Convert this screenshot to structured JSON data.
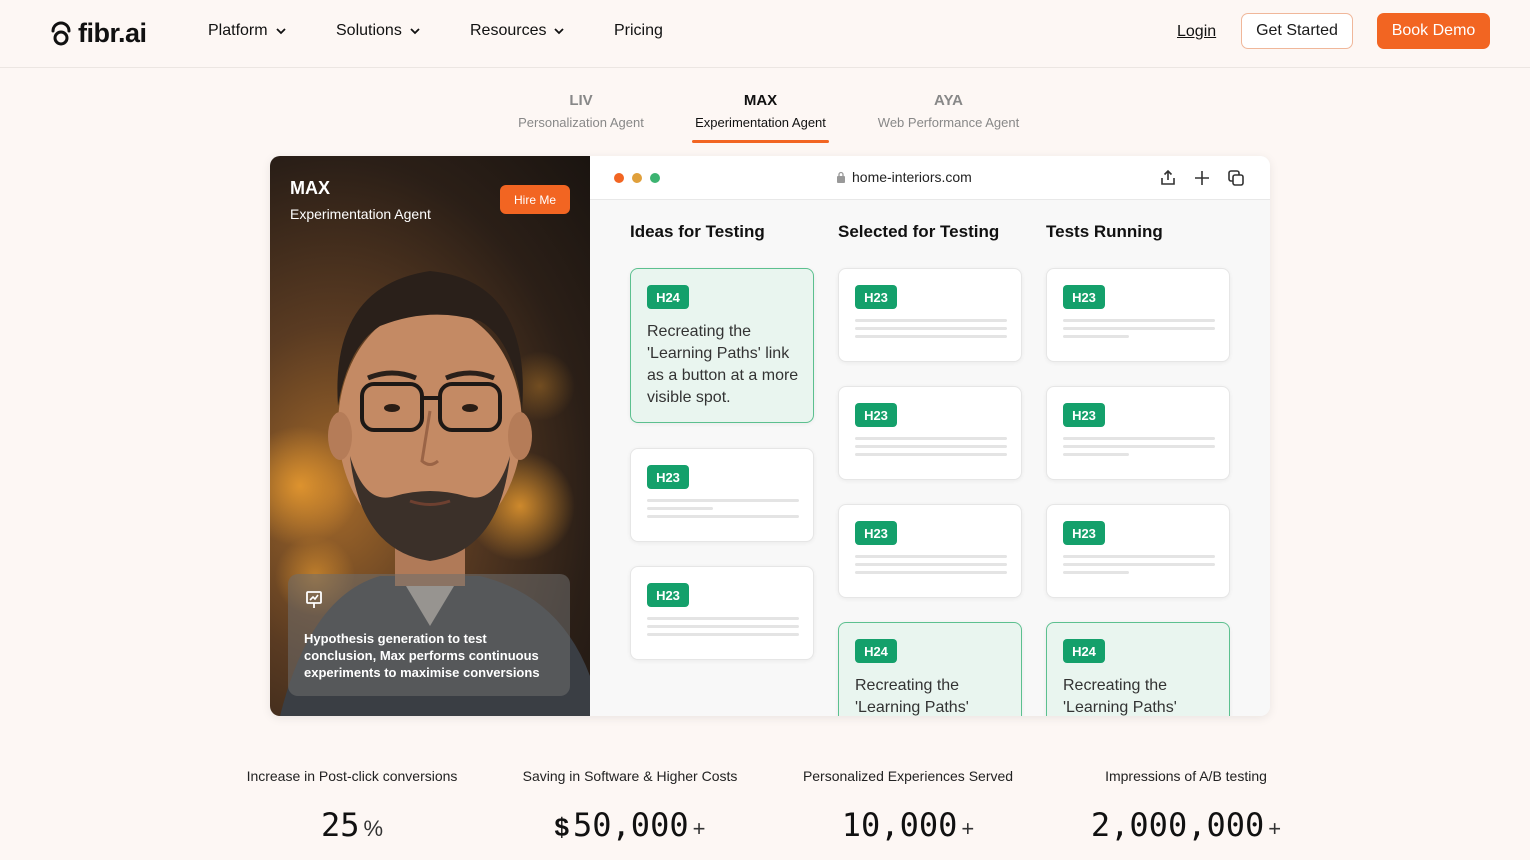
{
  "brand": {
    "name": "fibr.ai",
    "accent": "#f26522",
    "green": "#14a06b"
  },
  "nav": {
    "items": [
      {
        "label": "Platform",
        "has_dropdown": true
      },
      {
        "label": "Solutions",
        "has_dropdown": true
      },
      {
        "label": "Resources",
        "has_dropdown": true
      },
      {
        "label": "Pricing",
        "has_dropdown": false
      }
    ],
    "login": "Login",
    "get_started": "Get Started",
    "book_demo": "Book Demo"
  },
  "agents": [
    {
      "name": "LIV",
      "role": "Personalization Agent",
      "active": false
    },
    {
      "name": "MAX",
      "role": "Experimentation Agent",
      "active": true
    },
    {
      "name": "AYA",
      "role": "Web Performance Agent",
      "active": false
    }
  ],
  "portrait": {
    "name": "MAX",
    "role": "Experimentation Agent",
    "hire_label": "Hire Me",
    "caption": "Hypothesis generation to test conclusion, Max performs continuous experiments to maximise conversions"
  },
  "browser": {
    "url": "home-interiors.com",
    "columns": [
      {
        "title": "Ideas for Testing"
      },
      {
        "title": "Selected for Testing"
      },
      {
        "title": "Tests Running"
      }
    ],
    "highlight_card": {
      "tag": "H24",
      "text": "Recreating the 'Learning Paths' link as a button at a more visible spot."
    },
    "partial_card_text": "Recreating the 'Learning Paths'",
    "default_tag": "H23"
  },
  "stats": [
    {
      "label": "Increase in Post-click conversions",
      "prefix": "",
      "value": "25",
      "suffix": "%"
    },
    {
      "label": "Saving in Software & Higher Costs",
      "prefix": "$",
      "value": "50,000",
      "suffix": "+"
    },
    {
      "label": "Personalized Experiences Served",
      "prefix": "",
      "value": "10,000",
      "suffix": "+"
    },
    {
      "label": "Impressions of A/B testing",
      "prefix": "",
      "value": "2,000,000",
      "suffix": "+"
    }
  ]
}
